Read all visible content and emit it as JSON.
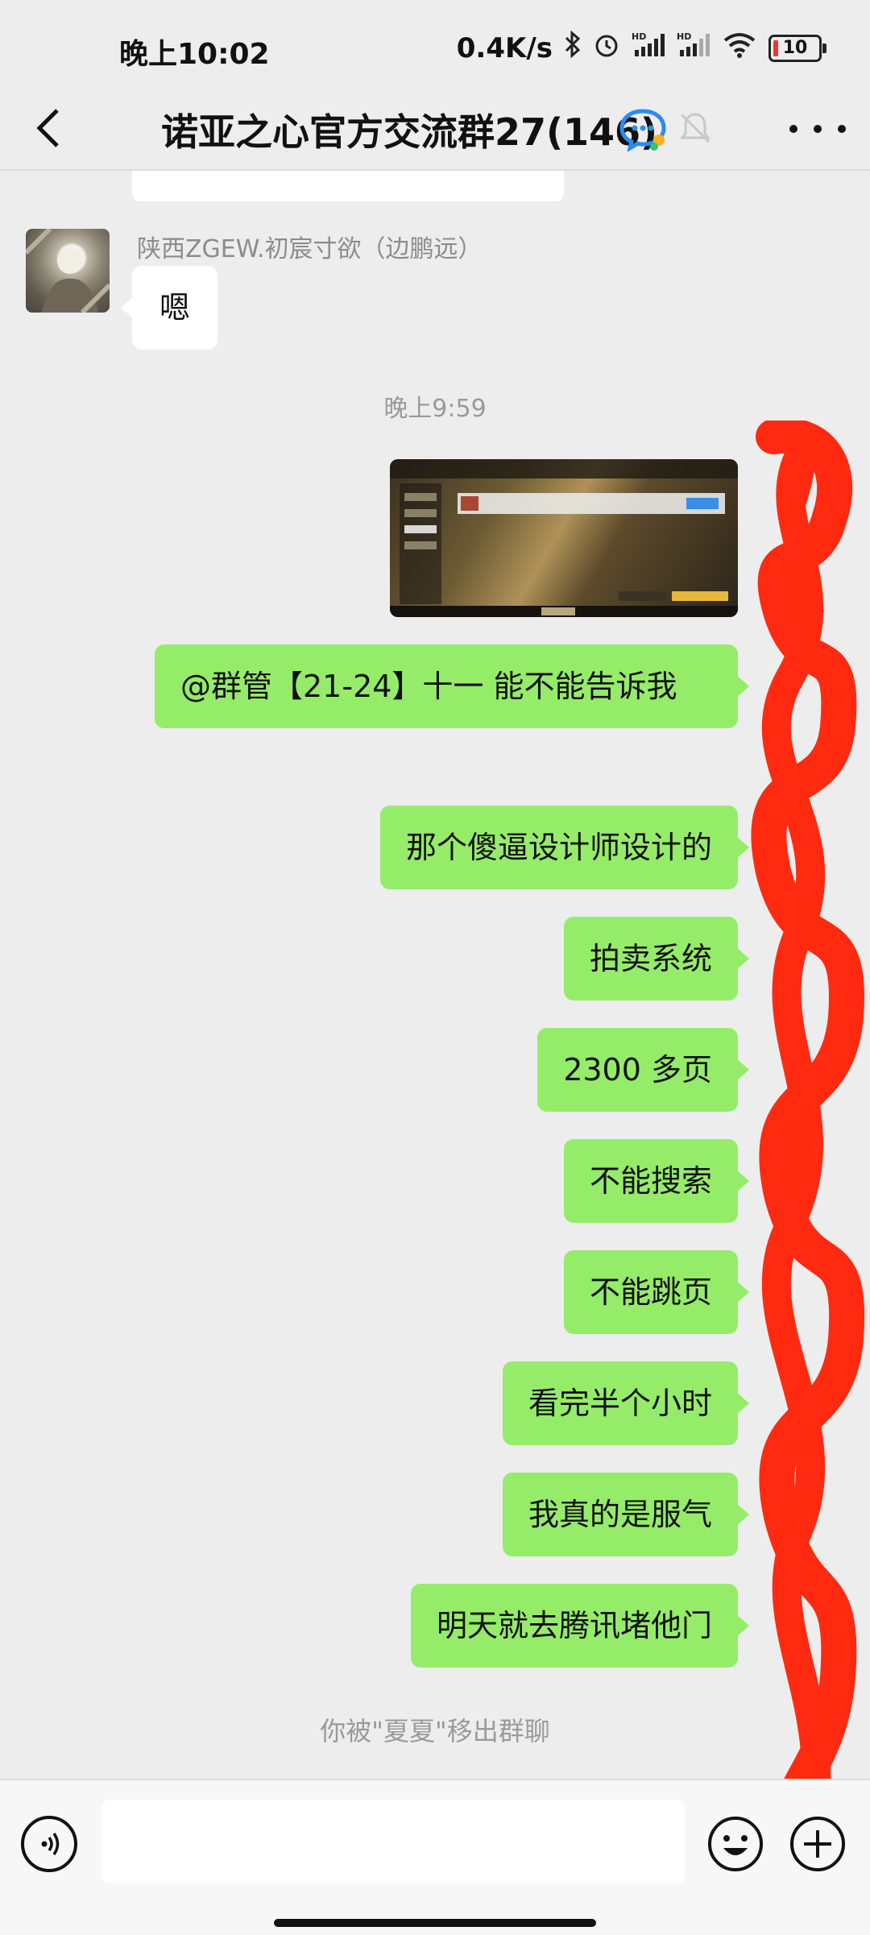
{
  "status_bar": {
    "time": "晚上10:02",
    "net_speed": "0.4K/s",
    "battery_level": "10"
  },
  "header": {
    "title": "诺亚之心官方交流群27(146)"
  },
  "messages": {
    "incoming_sender": "陕西ZGEW.初宸寸欲（边鹏远）",
    "incoming_text": "嗯",
    "time_separator": "晚上9:59",
    "outgoing": [
      "@群管【21-24】十一  能不能告诉我",
      "那个傻逼设计师设计的",
      "拍卖系统",
      "2300 多页",
      "不能搜索",
      "不能跳页",
      "看完半个小时",
      "我真的是服气",
      "明天就去腾讯堵他门"
    ],
    "system_notice": "你被\"夏夏\"移出群聊"
  },
  "colors": {
    "outgoing_bubble": "#95ec69",
    "incoming_bubble": "#ffffff",
    "background": "#ededed",
    "scribble": "#ff2a10"
  }
}
